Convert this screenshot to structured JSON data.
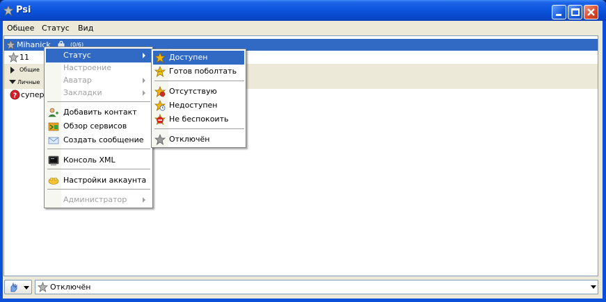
{
  "window": {
    "title": "Psi"
  },
  "menubar": {
    "items": [
      "Общее",
      "Статус",
      "Вид"
    ]
  },
  "roster": {
    "account_name": "Mihanick",
    "account_count": "(0/6)",
    "rows": [
      {
        "text": "11"
      },
      {
        "text": "Общие"
      },
      {
        "text": "Личные"
      },
      {
        "text": "супер"
      }
    ]
  },
  "context_menu": {
    "items": [
      {
        "label": "Статус",
        "state": "highlighted",
        "submenu": true
      },
      {
        "label": "Настроение",
        "state": "disabled"
      },
      {
        "label": "Аватар",
        "state": "disabled",
        "submenu": true
      },
      {
        "label": "Закладки",
        "state": "disabled",
        "submenu": true
      },
      {
        "label": "Добавить контакт",
        "icon": "add-contact-icon"
      },
      {
        "label": "Обзор сервисов",
        "icon": "service-discovery-icon"
      },
      {
        "label": "Создать сообщение",
        "icon": "envelope-icon"
      },
      {
        "label": "Консоль XML",
        "icon": "console-icon"
      },
      {
        "label": "Настройки аккаунта",
        "icon": "account-settings-icon"
      },
      {
        "label": "Администратор",
        "state": "disabled",
        "submenu": true
      }
    ]
  },
  "status_menu": {
    "items": [
      {
        "label": "Доступен",
        "state": "highlighted",
        "icon": "online-star-icon"
      },
      {
        "label": "Готов поболтать",
        "icon": "chat-star-icon"
      },
      {
        "label": "Отсутствую",
        "icon": "away-star-icon"
      },
      {
        "label": "Недоступен",
        "icon": "xa-star-icon"
      },
      {
        "label": "Не беспокоить",
        "icon": "dnd-star-icon"
      },
      {
        "label": "Отключён",
        "icon": "offline-star-icon"
      }
    ]
  },
  "statusbar": {
    "current_status": "Отключён"
  },
  "colors": {
    "highlight": "#316ac5",
    "titlebar": "#0b54dc",
    "online": "#f5b800",
    "offline": "#9a9a9a"
  }
}
